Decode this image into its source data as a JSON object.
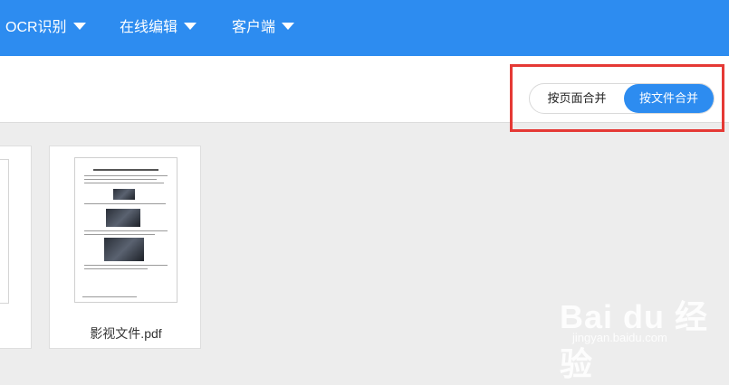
{
  "nav": {
    "items": [
      {
        "label": "OCR识别"
      },
      {
        "label": "在线编辑"
      },
      {
        "label": "客户端"
      }
    ]
  },
  "merge_toggle": {
    "by_page": "按页面合并",
    "by_file": "按文件合并",
    "selected": "按文件合并"
  },
  "files": [
    {
      "name": "影视文件.pdf"
    }
  ],
  "watermark": {
    "logo": "Bai du 经验",
    "url": "jingyan.baidu.com"
  },
  "colors": {
    "primary": "#2d8cf0",
    "highlight_box": "#e53935",
    "background": "#ededed"
  }
}
